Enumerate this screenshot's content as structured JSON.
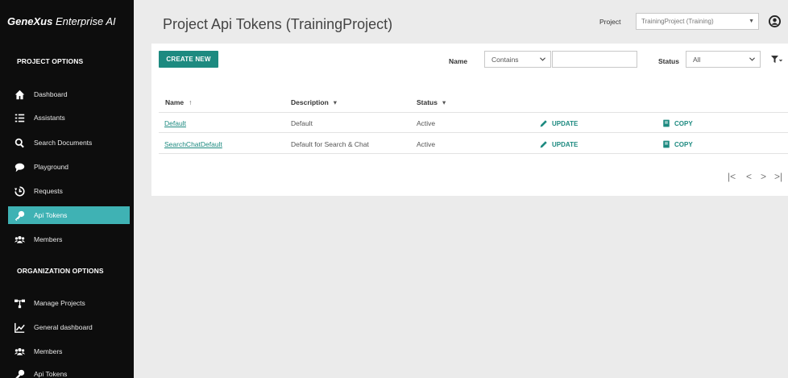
{
  "app": {
    "brand_main": "GeneXus",
    "brand_rest": " Enterprise AI"
  },
  "sidebar": {
    "project_section": "PROJECT OPTIONS",
    "project_items": [
      {
        "label": "Dashboard",
        "icon": "home-icon"
      },
      {
        "label": "Assistants",
        "icon": "list-icon"
      },
      {
        "label": "Search Documents",
        "icon": "search-icon"
      },
      {
        "label": "Playground",
        "icon": "chat-bubble-icon"
      },
      {
        "label": "Requests",
        "icon": "history-icon"
      },
      {
        "label": "Api Tokens",
        "icon": "key-icon",
        "active": true
      },
      {
        "label": "Members",
        "icon": "users-icon"
      }
    ],
    "org_section": "ORGANIZATION OPTIONS",
    "org_items": [
      {
        "label": "Manage Projects",
        "icon": "sitemap-icon"
      },
      {
        "label": "General dashboard",
        "icon": "line-chart-icon"
      },
      {
        "label": "Members",
        "icon": "users-icon"
      },
      {
        "label": "Api Tokens",
        "icon": "key-icon"
      }
    ]
  },
  "header": {
    "title": "Project Api Tokens (TrainingProject)",
    "project_label": "Project",
    "project_value": "TrainingProject (Training)"
  },
  "toolbar": {
    "create_label": "CREATE NEW",
    "name_label": "Name",
    "name_operator": "Contains",
    "name_value": "",
    "status_label": "Status",
    "status_value": "All"
  },
  "table": {
    "columns": [
      {
        "label": "Name",
        "sort": "↑"
      },
      {
        "label": "Description",
        "sort": "▾"
      },
      {
        "label": "Status",
        "sort": "▾"
      }
    ],
    "rows": [
      {
        "name": "Default",
        "description": "Default",
        "status": "Active",
        "update": "UPDATE",
        "copy": "COPY"
      },
      {
        "name": "SearchChatDefault",
        "description": "Default for Search & Chat",
        "status": "Active",
        "update": "UPDATE",
        "copy": "COPY"
      }
    ]
  },
  "pager": {
    "first": "|<",
    "prev": "<",
    "next": ">",
    "last": ">|"
  },
  "colors": {
    "accent": "#1d8a80",
    "active_nav": "#3fb2b4",
    "sidebar_bg": "#0d0d0d"
  }
}
